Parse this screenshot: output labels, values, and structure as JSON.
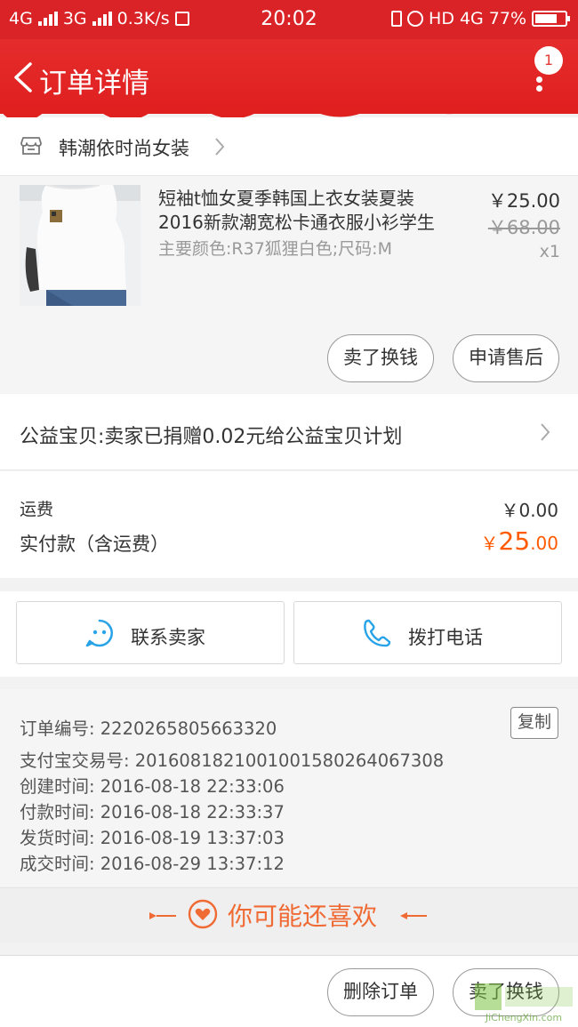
{
  "status_bar": {
    "net1": "4G",
    "net2": "3G",
    "speed": "0.3K/s",
    "time": "20:02",
    "hd": "HD",
    "net3": "4G",
    "battery": "77%"
  },
  "header": {
    "title": "订单详情",
    "badge": "1"
  },
  "shop": {
    "name": "韩潮依时尚女装"
  },
  "product": {
    "title_line1": "短袖t恤女夏季韩国上衣女装夏装",
    "title_line2": "2016新款潮宽松卡通衣服小衫学生",
    "spec": "主要颜色:R37狐狸白色;尺码:M",
    "price": "￥25.00",
    "original_price": "￥68.00",
    "quantity": "x1",
    "sell_button": "卖了换钱",
    "aftersale_button": "申请售后"
  },
  "charity": {
    "text": "公益宝贝:卖家已捐赠0.02元给公益宝贝计划"
  },
  "totals": {
    "shipping_label": "运费",
    "shipping_value": "￥0.00",
    "paid_label": "实付款（含运费）",
    "paid_currency": "￥",
    "paid_integer": "25",
    "paid_decimal": ".00"
  },
  "contact": {
    "seller_label": "联系卖家",
    "phone_label": "拨打电话"
  },
  "order_info": {
    "order_no": "订单编号: 2220265805663320",
    "alipay_no": "支付宝交易号: 2016081821001001580264067308",
    "created": "创建时间: 2016-08-18 22:33:06",
    "paid": "付款时间: 2016-08-18 22:33:37",
    "shipped": "发货时间: 2016-08-19 13:37:03",
    "completed": "成交时间: 2016-08-29 13:37:12",
    "copy_button": "复制"
  },
  "recommend": {
    "title": "你可能还喜欢"
  },
  "bottom_bar": {
    "delete_button": "删除订单",
    "sell_button": "卖了换钱"
  },
  "watermark": {
    "text": "JiChengXin.com"
  },
  "colors": {
    "header_red": "#e01f1f",
    "price_orange": "#ff5a00",
    "accent_orange": "#f06a34",
    "icon_blue": "#29a3e8"
  }
}
